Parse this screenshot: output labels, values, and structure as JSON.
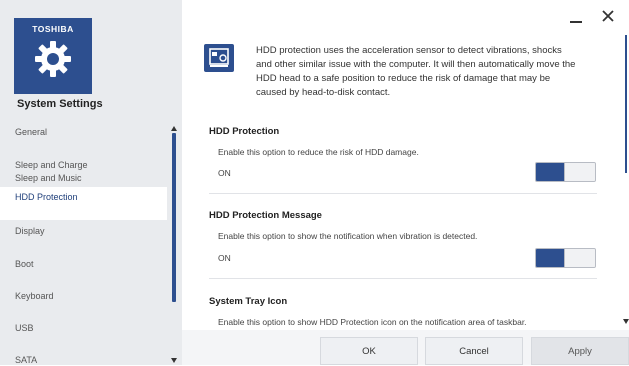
{
  "brand": {
    "logo_text": "TOSHIBA",
    "tile_color": "#2d4f8f",
    "icon": "gear-icon"
  },
  "app": {
    "title": "System Settings"
  },
  "window": {
    "minimize_icon": "minimize-icon",
    "close_icon": "close-icon"
  },
  "sidebar": {
    "items": [
      {
        "label": "General",
        "active": false
      },
      {
        "label": "Sleep and Charge",
        "active": false
      },
      {
        "label": "Sleep and Music",
        "active": false
      },
      {
        "label": "HDD Protection",
        "active": true
      },
      {
        "label": "Display",
        "active": false
      },
      {
        "label": "Boot",
        "active": false
      },
      {
        "label": "Keyboard",
        "active": false
      },
      {
        "label": "USB",
        "active": false
      },
      {
        "label": "SATA",
        "active": false
      }
    ]
  },
  "info": {
    "icon": "hdd-protection-icon",
    "text": "HDD protection uses the acceleration sensor to detect vibrations, shocks and other similar issue with the computer. It will then automatically move the HDD head to a safe position to reduce the risk of damage that may be caused by head-to-disk contact."
  },
  "sections": [
    {
      "title": "HDD Protection",
      "description": "Enable this option to reduce the risk of HDD damage.",
      "state": "ON",
      "enabled": true
    },
    {
      "title": "HDD Protection Message",
      "description": "Enable this option to show the notification when vibration is detected.",
      "state": "ON",
      "enabled": true
    },
    {
      "title": "System Tray Icon",
      "description": "Enable this option to show HDD Protection icon on the notification area of taskbar."
    }
  ],
  "footer": {
    "ok": "OK",
    "cancel": "Cancel",
    "apply": "Apply"
  },
  "colors": {
    "accent": "#2d4f8f",
    "sidebar_bg": "#e9ebee",
    "selected_bg": "#ffffff"
  }
}
